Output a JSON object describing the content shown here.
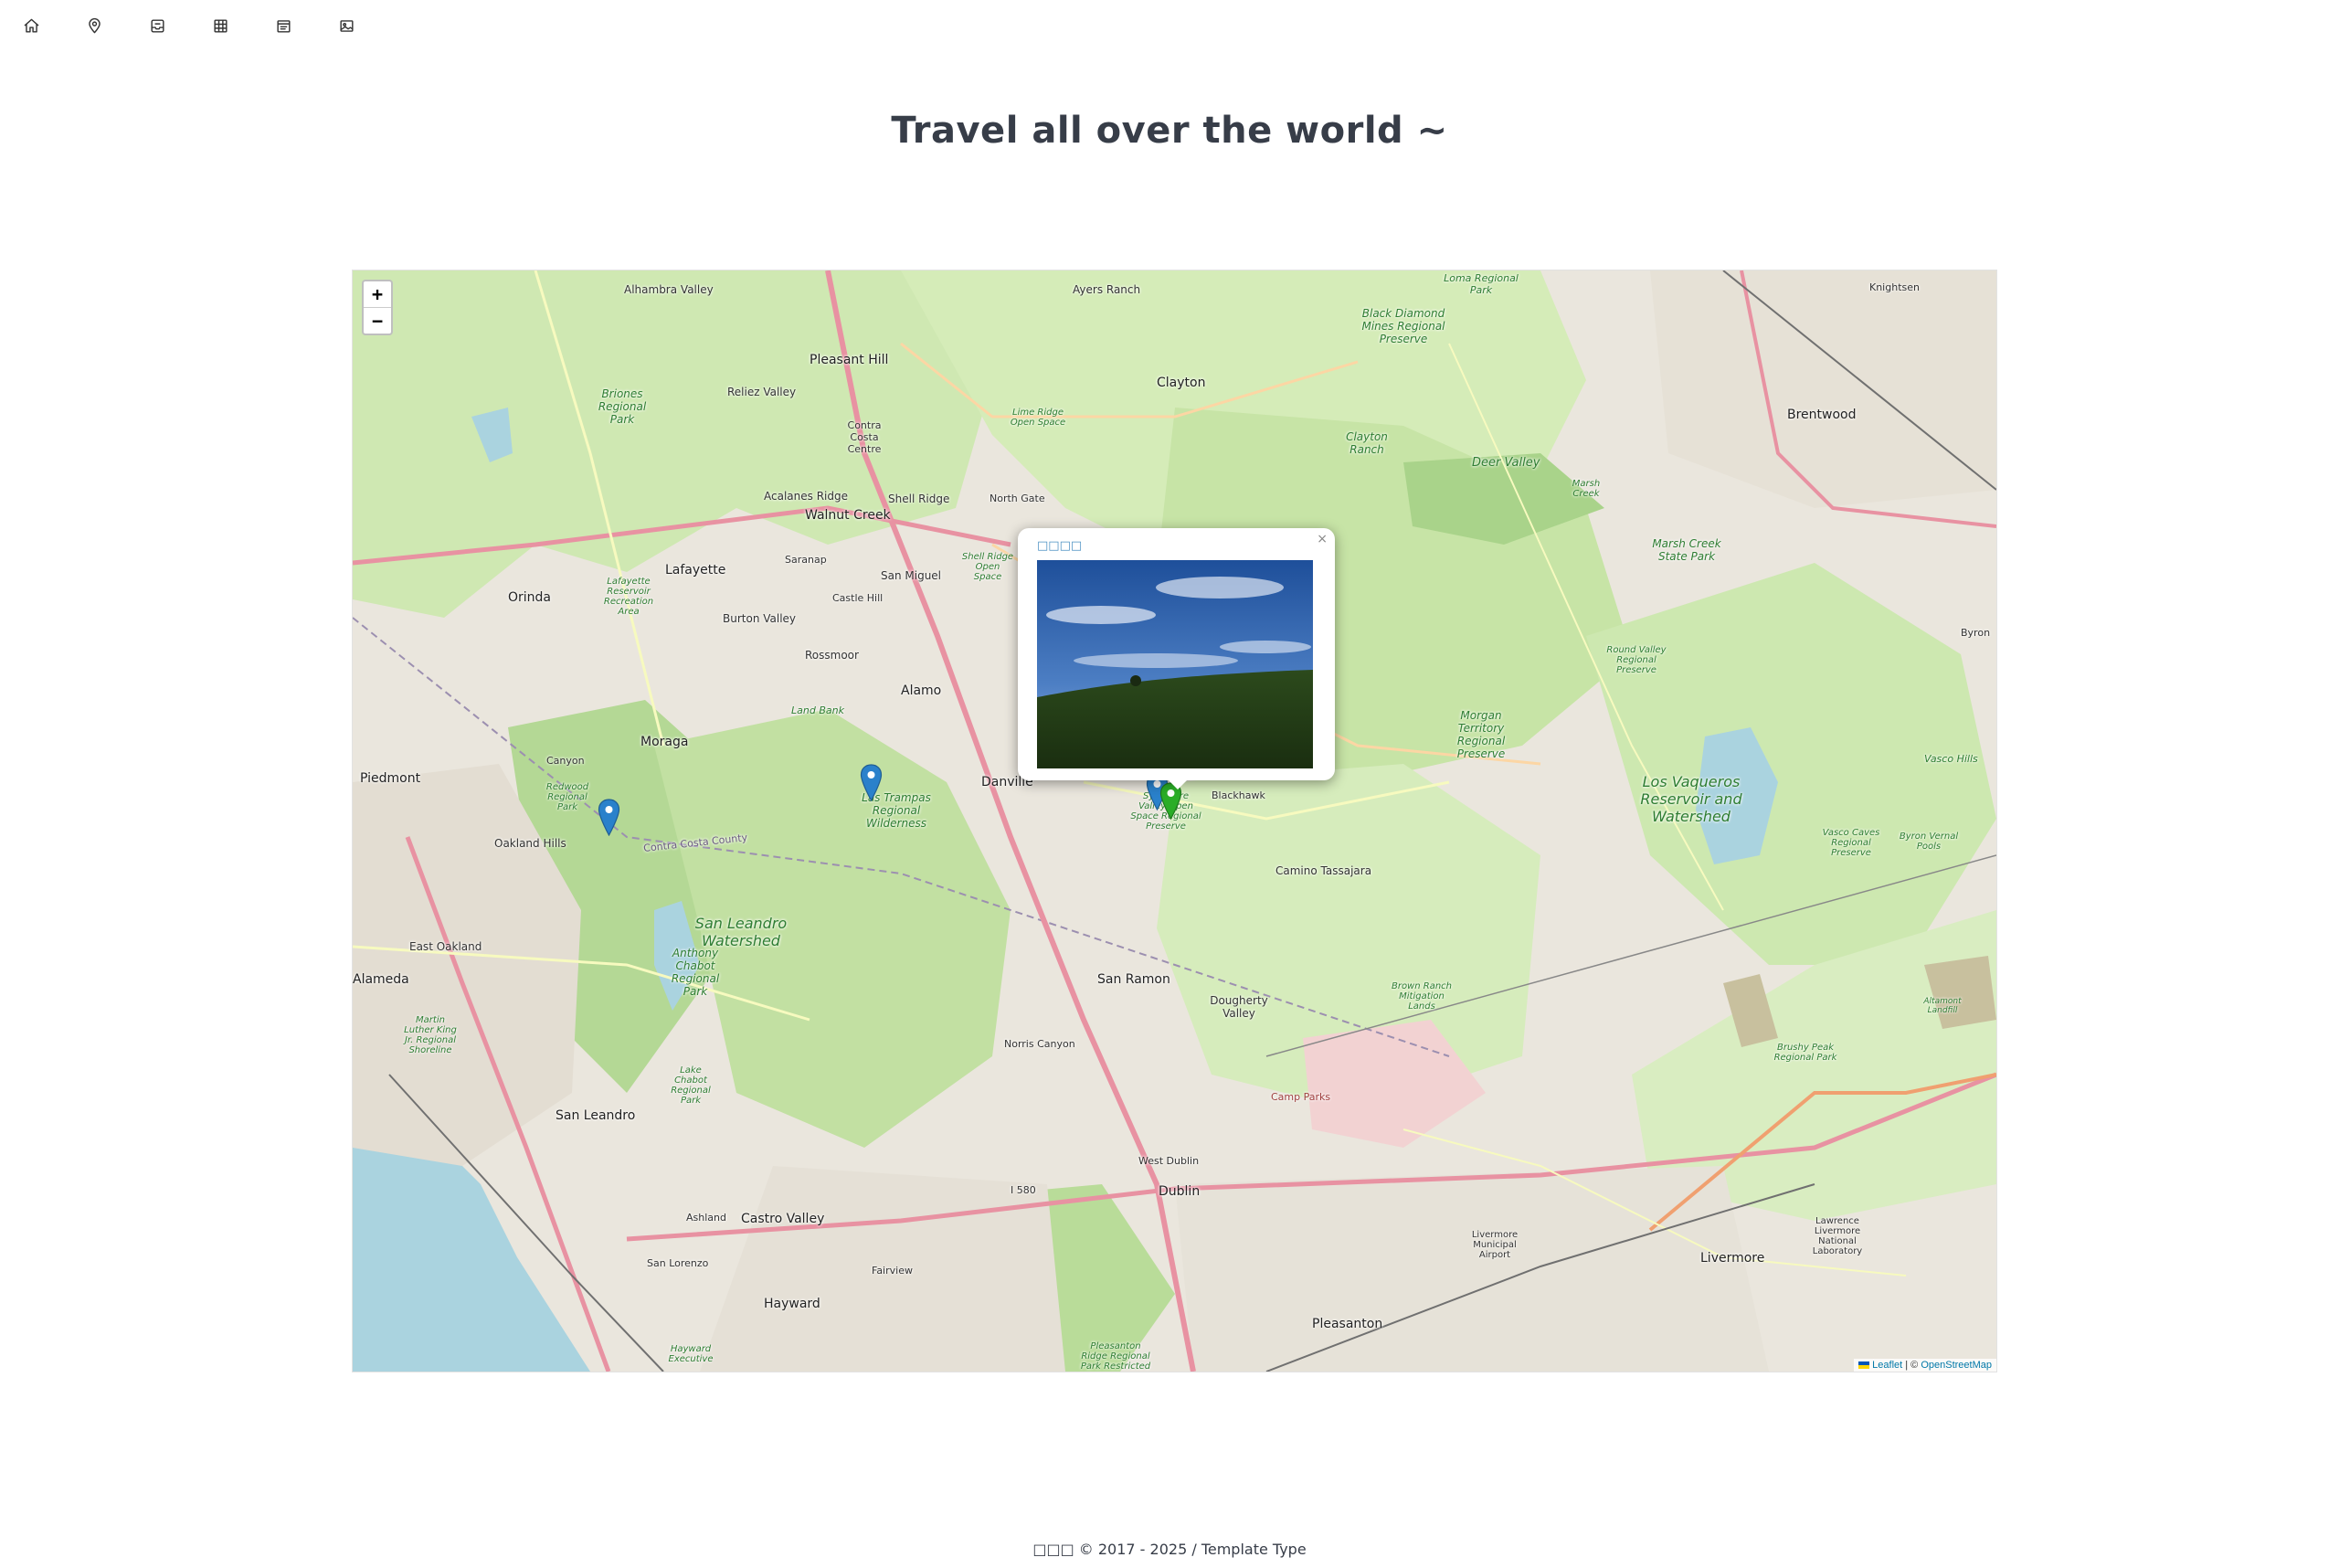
{
  "nav": {
    "items": [
      {
        "icon": "home-icon"
      },
      {
        "icon": "map-pin-icon"
      },
      {
        "icon": "inbox-icon"
      },
      {
        "icon": "table-icon"
      },
      {
        "icon": "calendar-list-icon"
      },
      {
        "icon": "image-icon"
      }
    ]
  },
  "page": {
    "title": "Travel all over the world ~"
  },
  "map": {
    "zoom_in": "+",
    "zoom_out": "−",
    "labels": {
      "alhambra_valley": "Alhambra Valley",
      "ayers_ranch": "Ayers Ranch",
      "knightsen": "Knightsen",
      "loma_regional_park": "Loma Regional Park",
      "pleasant_hill": "Pleasant Hill",
      "clayton": "Clayton",
      "black_diamond": "Black Diamond Mines Regional Preserve",
      "brentwood": "Brentwood",
      "briones": "Briones Regional Park",
      "reliez_valley": "Reliez Valley",
      "contra_costa_centre": "Contra Costa Centre",
      "lime_ridge": "Lime Ridge Open Space",
      "clayton_ranch": "Clayton Ranch",
      "acalanes_ridge": "Acalanes Ridge",
      "shell_ridge": "Shell Ridge",
      "north_gate": "North Gate",
      "deer_valley": "Deer Valley",
      "marsh_creek": "Marsh Creek",
      "walnut_creek": "Walnut Creek",
      "marsh_creek_park": "Marsh Creek State Park",
      "lafayette": "Lafayette",
      "saranap": "Saranap",
      "san_miguel": "San Miguel",
      "shell_ridge_os": "Shell Ridge Open Space",
      "orinda": "Orinda",
      "lafayette_reservoir": "Lafayette Reservoir Recreation Area",
      "castle_hill": "Castle Hill",
      "burton_valley": "Burton Valley",
      "byron": "Byron",
      "round_valley": "Round Valley Regional Preserve",
      "rossmoor": "Rossmoor",
      "alamo": "Alamo",
      "morgan_territory": "Morgan Territory Regional Preserve",
      "land_bank": "Land Bank",
      "moraga": "Moraga",
      "danville": "Danville",
      "blackhawk": "Blackhawk",
      "vasco_hills": "Vasco Hills",
      "los_vaqueros": "Los Vaqueros Reservoir and Watershed",
      "piedmont": "Piedmont",
      "canyon": "Canyon",
      "redwood": "Redwood Regional Park",
      "las_trampas": "Las Trampas Regional Wilderness",
      "sycamore": "Sycamore Valley Open Space Regional Preserve",
      "vasco_caves": "Vasco Caves Regional Preserve",
      "byron_vernal": "Byron Vernal Pools",
      "oakland_hills": "Oakland Hills",
      "camino_tassajara": "Camino Tassajara",
      "san_leandro_ws": "San Leandro Watershed",
      "east_oakland": "East Oakland",
      "anthony_chabot": "Anthony Chabot Regional Park",
      "san_ramon": "San Ramon",
      "alameda": "Alameda",
      "brown_ranch": "Brown Ranch Mitigation Lands",
      "dougherty": "Dougherty Valley",
      "altamont": "Altamont Landfill",
      "mlk": "Martin Luther King Jr. Regional Shoreline",
      "norris_canyon": "Norris Canyon",
      "brushy_peak": "Brushy Peak Regional Park",
      "lake_chabot": "Lake Chabot Regional Park",
      "camp_parks": "Camp Parks",
      "san_leandro": "San Leandro",
      "west_dublin": "West Dublin",
      "i580": "I 580",
      "dublin": "Dublin",
      "lawrence": "Lawrence Livermore National Laboratory",
      "livermore_airport": "Livermore Municipal Airport",
      "ashland": "Ashland",
      "castro_valley": "Castro Valley",
      "livermore": "Livermore",
      "san_lorenzo": "San Lorenzo",
      "fairview": "Fairview",
      "hayward": "Hayward",
      "pleasanton": "Pleasanton",
      "hayward_exec": "Hayward Executive",
      "pleasanton_ridge": "Pleasanton Ridge Regional Park Restricted",
      "contra_costa_county": "Contra Costa County"
    },
    "popup": {
      "title": "□□□□",
      "close": "×"
    },
    "attribution": {
      "leaflet": "Leaflet",
      "separator": " | © ",
      "osm": "OpenStreetMap"
    }
  },
  "footer": {
    "text": "□□□ © 2017 - 2025 / Template Type"
  },
  "colors": {
    "title": "#373d48",
    "marker_blue": "#2a81cb",
    "marker_green": "#2aad27",
    "park_green": "#cde8b0",
    "water": "#aad3df",
    "highway": "#e892a2",
    "road": "#f7fabf"
  }
}
